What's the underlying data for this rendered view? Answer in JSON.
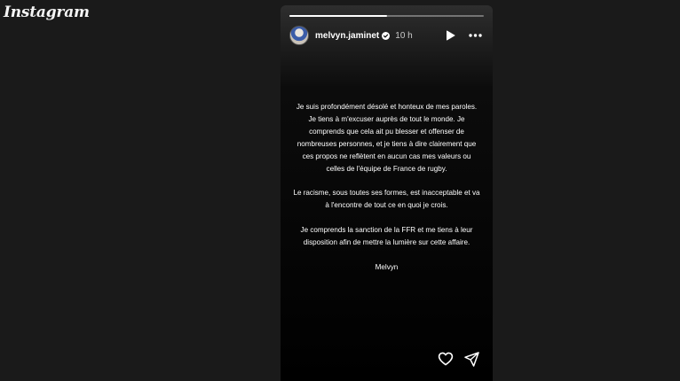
{
  "app": {
    "logo_text": "Instagram"
  },
  "story": {
    "progress": 0.5,
    "username": "melvyn.jaminet",
    "verified": true,
    "time_ago": "10 h",
    "paragraphs": [
      "Je suis profondément désolé et honteux de mes paroles. Je tiens à m'excuser auprès de tout le monde. Je comprends que cela ait pu blesser et offenser de nombreuses personnes, et je tiens à dire clairement que ces propos ne reflètent en aucun cas mes valeurs ou celles de l'équipe de France de rugby.",
      "Le racisme, sous toutes ses formes, est inacceptable et va à l'encontre de tout ce en quoi je crois.",
      "Je comprends la sanction de la FFR et me tiens à leur disposition afin de mettre la lumière sur cette affaire.",
      "Melvyn"
    ]
  },
  "icons": {
    "verified": "verified-badge-icon",
    "play": "play-icon",
    "more": "more-options-icon",
    "like": "heart-icon",
    "share": "send-icon"
  }
}
